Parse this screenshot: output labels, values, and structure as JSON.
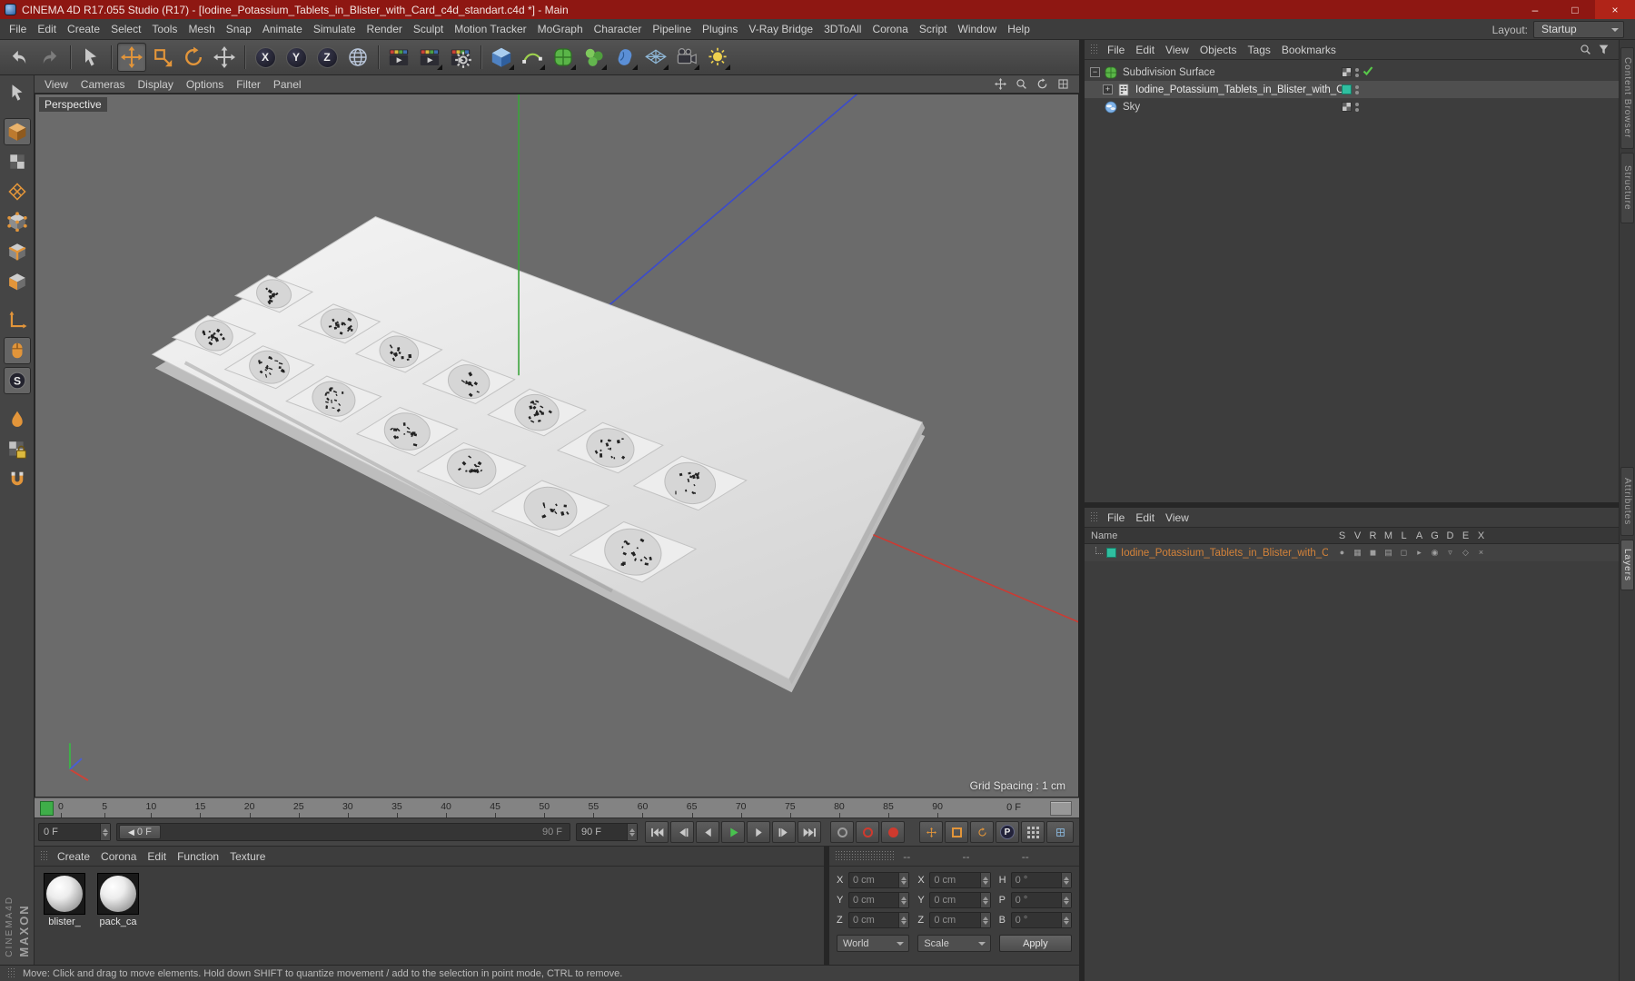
{
  "window": {
    "title": "CINEMA 4D R17.055 Studio (R17) - [Iodine_Potassium_Tablets_in_Blister_with_Card_c4d_standart.c4d *] - Main",
    "controls": {
      "minimize": "–",
      "maximize": "□",
      "close": "×"
    }
  },
  "menu_bar": {
    "items": [
      "File",
      "Edit",
      "Create",
      "Select",
      "Tools",
      "Mesh",
      "Snap",
      "Animate",
      "Simulate",
      "Render",
      "Sculpt",
      "Motion Tracker",
      "MoGraph",
      "Character",
      "Pipeline",
      "Plugins",
      "V-Ray Bridge",
      "3DToAll",
      "Corona",
      "Script",
      "Window",
      "Help"
    ],
    "layout_label": "Layout:",
    "layout_value": "Startup"
  },
  "toolbar": {
    "axis_buttons": [
      "X",
      "Y",
      "Z"
    ]
  },
  "viewport": {
    "menu_items": [
      "View",
      "Cameras",
      "Display",
      "Options",
      "Filter",
      "Panel"
    ],
    "view_name": "Perspective",
    "grid_spacing_label": "Grid Spacing : 1 cm"
  },
  "timeline": {
    "ruler_ticks": [
      "0",
      "5",
      "10",
      "15",
      "20",
      "25",
      "30",
      "35",
      "40",
      "45",
      "50",
      "55",
      "60",
      "65",
      "70",
      "75",
      "80",
      "85",
      "90"
    ],
    "current_frame": "0 F",
    "frame_field": "0 F",
    "range_start": "0 F",
    "range_end": "90 F",
    "end_field": "90 F",
    "parameter_badge": "P"
  },
  "materials_panel": {
    "menu_items": [
      "Create",
      "Corona",
      "Edit",
      "Function",
      "Texture"
    ],
    "materials": [
      {
        "label": "blister_"
      },
      {
        "label": "pack_ca"
      }
    ]
  },
  "coordinates_panel": {
    "menu_placeholders": [
      "--",
      "--",
      "--"
    ],
    "position": {
      "rows": [
        {
          "axis": "X",
          "value": "0 cm"
        },
        {
          "axis": "Y",
          "value": "0 cm"
        },
        {
          "axis": "Z",
          "value": "0 cm"
        }
      ]
    },
    "size": {
      "rows": [
        {
          "axis": "X",
          "value": "0 cm"
        },
        {
          "axis": "Y",
          "value": "0 cm"
        },
        {
          "axis": "Z",
          "value": "0 cm"
        }
      ]
    },
    "rotation": {
      "rows": [
        {
          "axis": "H",
          "value": "0 °"
        },
        {
          "axis": "P",
          "value": "0 °"
        },
        {
          "axis": "B",
          "value": "0 °"
        }
      ]
    },
    "transform_mode": "World",
    "size_mode": "Scale",
    "apply_label": "Apply"
  },
  "object_manager": {
    "menu_items": [
      "File",
      "Edit",
      "View",
      "Objects",
      "Tags",
      "Bookmarks"
    ],
    "objects": [
      {
        "label": "Subdivision Surface"
      },
      {
        "label": "Iodine_Potassium_Tablets_in_Blister_with_Card"
      },
      {
        "label": "Sky"
      }
    ]
  },
  "layers_panel": {
    "menu_items": [
      "File",
      "Edit",
      "View"
    ],
    "name_header": "Name",
    "column_headers": [
      "S",
      "V",
      "R",
      "M",
      "L",
      "A",
      "G",
      "D",
      "E",
      "X"
    ],
    "layers": [
      {
        "label": "Iodine_Potassium_Tablets_in_Blister_with_Card",
        "color": "#2fbfa0"
      }
    ],
    "row_icons": [
      "●",
      "▦",
      "◼",
      "▤",
      "◻",
      "▸",
      "◉",
      "▿",
      "◇",
      "×"
    ]
  },
  "status_bar": {
    "message": "Move: Click and drag to move elements. Hold down SHIFT to quantize movement / add to the selection in point mode, CTRL to remove."
  },
  "side_tabs": [
    "Content Browser",
    "Structure",
    "Attributes",
    "Layers"
  ],
  "branding": {
    "maxon": "MAXON",
    "cinema": "CINEMA4D"
  }
}
